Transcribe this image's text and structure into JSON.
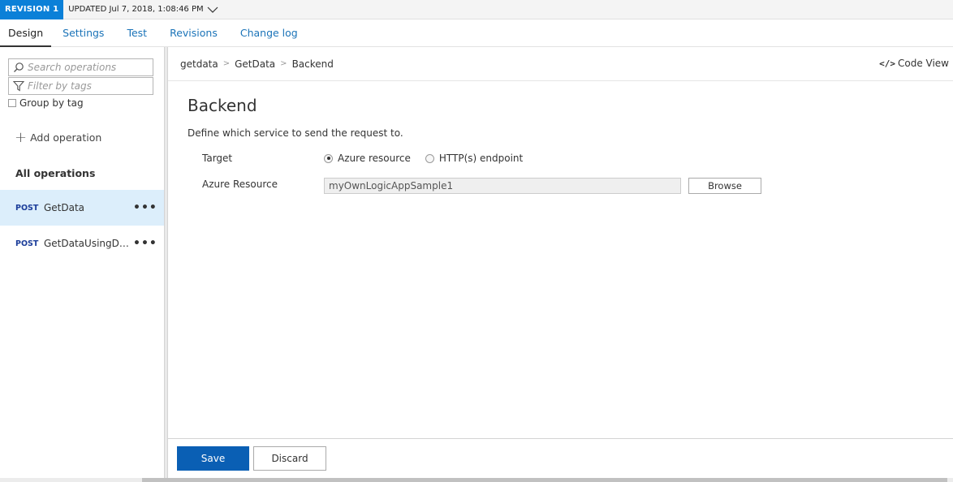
{
  "revision": {
    "badge": "REVISION 1",
    "updated": "UPDATED Jul 7, 2018, 1:08:46 PM",
    "chevron_icon": "chevron-down-icon"
  },
  "tabs": [
    {
      "label": "Design",
      "active": true
    },
    {
      "label": "Settings"
    },
    {
      "label": "Test"
    },
    {
      "label": "Revisions"
    },
    {
      "label": "Change log"
    }
  ],
  "sidebar": {
    "search_placeholder": "Search operations",
    "filter_placeholder": "Filter by tags",
    "group_by_tag": "Group by tag",
    "add_operation": "Add operation",
    "all_operations": "All operations",
    "operations": [
      {
        "method": "POST",
        "name": "GetData",
        "more": "•••",
        "selected": true
      },
      {
        "method": "POST",
        "name": "GetDataUsingDataContract",
        "more": "•••"
      }
    ]
  },
  "main": {
    "breadcrumb": [
      "getdata",
      "GetData",
      "Backend"
    ],
    "breadcrumb_sep": ">",
    "code_view_icon": "</>",
    "code_view": "Code View",
    "title": "Backend",
    "description": "Define which service to send the request to.",
    "target_label": "Target",
    "target_options": [
      {
        "label": "Azure resource",
        "selected": true
      },
      {
        "label": "HTTP(s) endpoint",
        "selected": false
      }
    ],
    "resource_label": "Azure Resource",
    "resource_value": "myOwnLogicAppSample1",
    "browse": "Browse",
    "save": "Save",
    "discard": "Discard"
  },
  "colors": {
    "accent": "#0b80d8",
    "save_button": "#0a5fb4",
    "selected_row": "#dceefb",
    "method": "#1b3d9a"
  }
}
